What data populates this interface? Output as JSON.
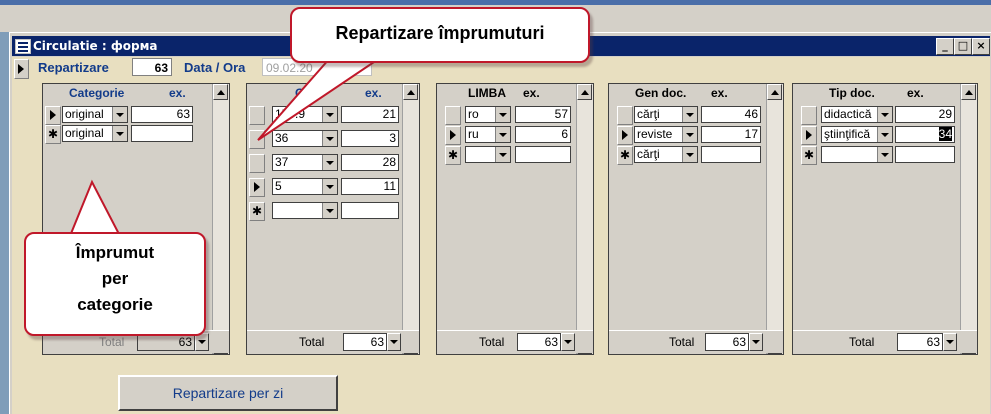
{
  "window": {
    "title": "Circulatie : форма"
  },
  "header": {
    "repartizare_label": "Repartizare",
    "repartizare_value": "63",
    "dataora_label": "Data / Ora",
    "dataora_value": "09.02.20"
  },
  "subforms": {
    "categorie": {
      "col1": "Categorie",
      "col2": "ex.",
      "rows": [
        {
          "v": "original",
          "n": "63"
        }
      ],
      "new_value": "original",
      "total_label": "Total",
      "total": "63"
    },
    "cota": {
      "col1": "C",
      "col2": "ex.",
      "rows": [
        {
          "v": "159.9",
          "n": "21"
        },
        {
          "v": "36",
          "n": "3"
        },
        {
          "v": "37",
          "n": "28"
        },
        {
          "v": "5",
          "n": "11"
        }
      ],
      "total_label": "Total",
      "total": "63"
    },
    "limba": {
      "col1": "LIMBA",
      "col2": "ex.",
      "rows": [
        {
          "v": "ro",
          "n": "57"
        },
        {
          "v": "ru",
          "n": "6"
        }
      ],
      "total_label": "Total",
      "total": "63"
    },
    "gen": {
      "col1": "Gen doc.",
      "col2": "ex.",
      "rows": [
        {
          "v": "cărţi",
          "n": "46"
        },
        {
          "v": "reviste",
          "n": "17"
        }
      ],
      "new_value": "cărţi",
      "total_label": "Total",
      "total": "63"
    },
    "tip": {
      "col1": "Tip doc.",
      "col2": "ex.",
      "rows": [
        {
          "v": "didactică",
          "n": "29"
        },
        {
          "v": "ştiinţifică",
          "n": "34"
        }
      ],
      "total_label": "Total",
      "total": "63"
    }
  },
  "buttons": {
    "per_zi": "Repartizare per zi"
  },
  "callouts": {
    "top": "Repartizare împrumuturi",
    "left_l1": "Împrumut",
    "left_l2": "per",
    "left_l3": "categorie"
  }
}
